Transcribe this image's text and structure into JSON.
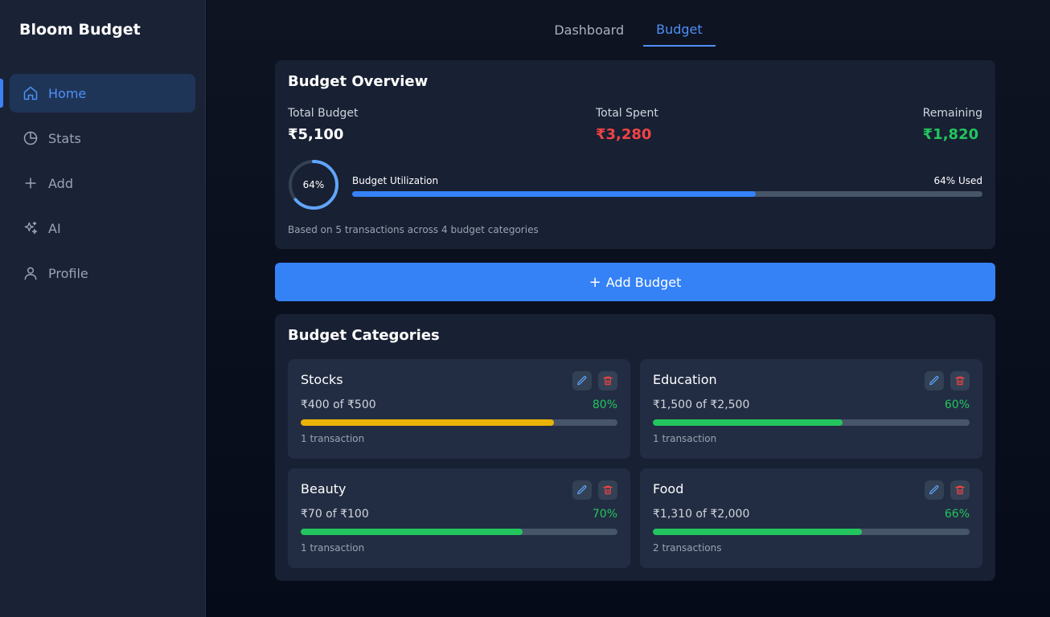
{
  "app": {
    "brand": "Bloom Budget"
  },
  "sidebar": {
    "items": [
      {
        "label": "Home",
        "icon": "home-icon",
        "active": true
      },
      {
        "label": "Stats",
        "icon": "pie-chart-icon",
        "active": false
      },
      {
        "label": "Add",
        "icon": "plus-icon",
        "active": false
      },
      {
        "label": "AI",
        "icon": "sparkles-icon",
        "active": false
      },
      {
        "label": "Profile",
        "icon": "user-icon",
        "active": false
      }
    ]
  },
  "tabs": [
    {
      "label": "Dashboard",
      "active": false
    },
    {
      "label": "Budget",
      "active": true
    }
  ],
  "overview": {
    "title": "Budget Overview",
    "total_budget_label": "Total Budget",
    "total_budget": "₹5,100",
    "total_spent_label": "Total Spent",
    "total_spent": "₹3,280",
    "remaining_label": "Remaining",
    "remaining": "₹1,820",
    "ring_text": "64%",
    "utilization_label": "Budget Utilization",
    "utilization_used": "64% Used",
    "utilization_fraction": 0.64,
    "note": "Based on 5 transactions across 4 budget categories"
  },
  "add_button": {
    "label": "Add Budget"
  },
  "categories_section": {
    "title": "Budget Categories",
    "items": [
      {
        "name": "Stocks",
        "amount": "₹400 of ₹500",
        "percent": "80%",
        "fraction": 0.8,
        "bar_color": "#eab308",
        "transactions": "1 transaction"
      },
      {
        "name": "Education",
        "amount": "₹1,500 of ₹2,500",
        "percent": "60%",
        "fraction": 0.6,
        "bar_color": "#22c55e",
        "transactions": "1 transaction"
      },
      {
        "name": "Beauty",
        "amount": "₹70 of ₹100",
        "percent": "70%",
        "fraction": 0.7,
        "bar_color": "#22c55e",
        "transactions": "1 transaction"
      },
      {
        "name": "Food",
        "amount": "₹1,310 of ₹2,000",
        "percent": "66%",
        "fraction": 0.66,
        "bar_color": "#22c55e",
        "transactions": "2 transactions"
      }
    ]
  },
  "colors": {
    "accent": "#3b82f6",
    "spent": "#ef4444",
    "remaining": "#22c55e",
    "warning": "#eab308"
  }
}
